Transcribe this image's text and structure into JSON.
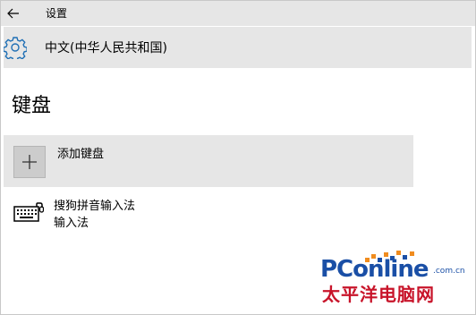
{
  "header": {
    "back_icon": "back-arrow-icon",
    "title": "设置"
  },
  "language": {
    "icon": "gear-icon",
    "label": "中文(中华人民共和国)"
  },
  "section": {
    "title": "键盘"
  },
  "add_keyboard": {
    "icon": "plus-icon",
    "label": "添加键盘"
  },
  "keyboards": [
    {
      "icon": "keyboard-icon",
      "name": "搜狗拼音输入法",
      "type": "输入法"
    }
  ],
  "watermark": {
    "brand_pc": "PC",
    "brand_online": "online",
    "domain": ".com.cn",
    "chinese": "太平洋电脑网",
    "colors": {
      "blue": "#1a4fa6",
      "red": "#c8142a",
      "orange": "#f08c1e"
    }
  }
}
